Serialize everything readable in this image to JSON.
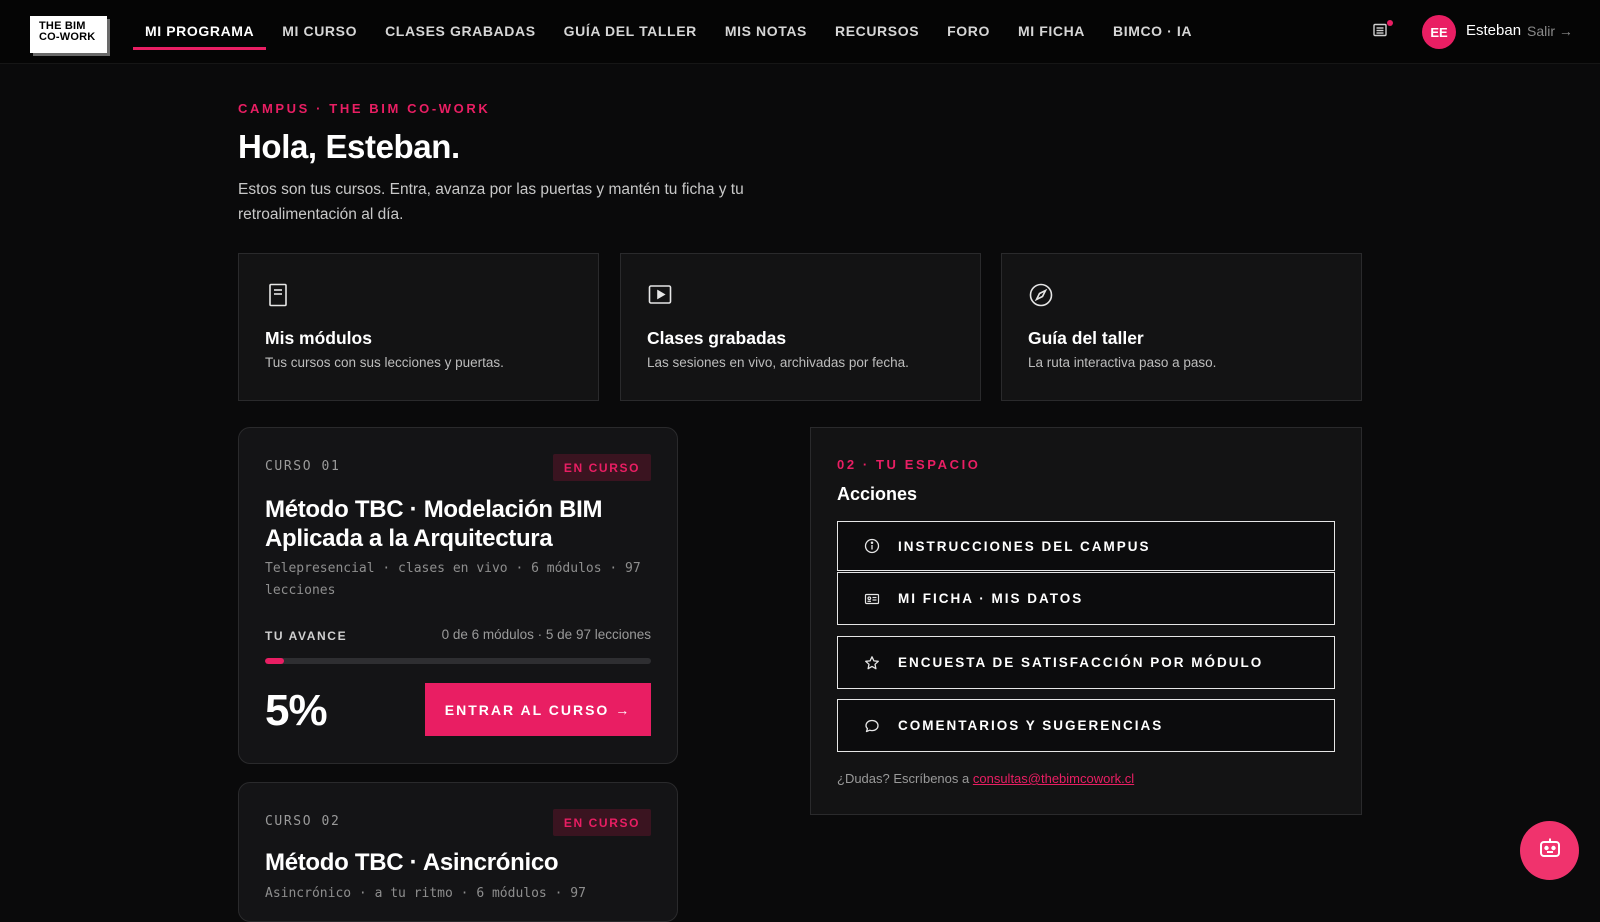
{
  "header": {
    "logo_line1": "THE BIM",
    "logo_line2": "CO-WORK",
    "nav": [
      {
        "label": "MI PROGRAMA",
        "active": true
      },
      {
        "label": "MI CURSO"
      },
      {
        "label": "CLASES GRABADAS"
      },
      {
        "label": "GUÍA DEL TALLER"
      },
      {
        "label": "MIS NOTAS"
      },
      {
        "label": "RECURSOS"
      },
      {
        "label": "FORO"
      },
      {
        "label": "MI FICHA"
      },
      {
        "label": "BIMCO · IA"
      }
    ],
    "notifications_icon": "inbox-icon",
    "avatar_initials": "EE",
    "user_name": "Esteban",
    "logout_label": "Salir →"
  },
  "hero": {
    "kicker": "CAMPUS · THE BIM CO-WORK",
    "title": "Hola, Esteban.",
    "intro": "Estos son tus cursos. Entra, avanza por las puertas y mantén tu ficha y tu retroalimentación al día."
  },
  "quick_links": [
    {
      "icon": "book-icon",
      "title": "Mis módulos",
      "desc": "Tus cursos con sus lecciones y puertas."
    },
    {
      "icon": "play-icon",
      "title": "Clases grabadas",
      "desc": "Las sesiones en vivo, archivadas por fecha."
    },
    {
      "icon": "compass-icon",
      "title": "Guía del taller",
      "desc": "La ruta interactiva paso a paso."
    }
  ],
  "courses": [
    {
      "number": "CURSO 01",
      "badge": "EN CURSO",
      "title": "Método TBC · Modelación BIM Aplicada a la Arquitectura",
      "meta": "Telepresencial · clases en vivo · 6 módulos · 97 lecciones",
      "progress_label": "TU AVANCE",
      "progress_count": "0 de 6 módulos · 5 de 97 lecciones",
      "progress_percent": 5,
      "progress_text": "5%",
      "enter_label": "ENTRAR AL CURSO →"
    },
    {
      "number": "CURSO 02",
      "badge": "EN CURSO",
      "title": "Método TBC · Asincrónico",
      "meta": "Asincrónico · a tu ritmo · 6 módulos · 97"
    }
  ],
  "space": {
    "kicker": "02 · TU ESPACIO",
    "title": "Acciones",
    "actions": [
      {
        "icon": "info-icon",
        "label": "INSTRUCCIONES DEL CAMPUS"
      },
      {
        "icon": "id-card-icon",
        "label": "MI FICHA · MIS DATOS"
      },
      {
        "icon": "star-icon",
        "label": "ENCUESTA DE SATISFACCIÓN POR MÓDULO"
      },
      {
        "icon": "chat-bubble-icon",
        "label": "COMENTARIOS Y SUGERENCIAS"
      }
    ],
    "help_text": "¿Dudas? Escríbenos a ",
    "help_email": "consultas@thebimcowork.cl"
  },
  "chatbot_icon": "robot-icon",
  "colors": {
    "accent": "#e91e63",
    "background": "#0a0a0b",
    "card": "#131314"
  }
}
